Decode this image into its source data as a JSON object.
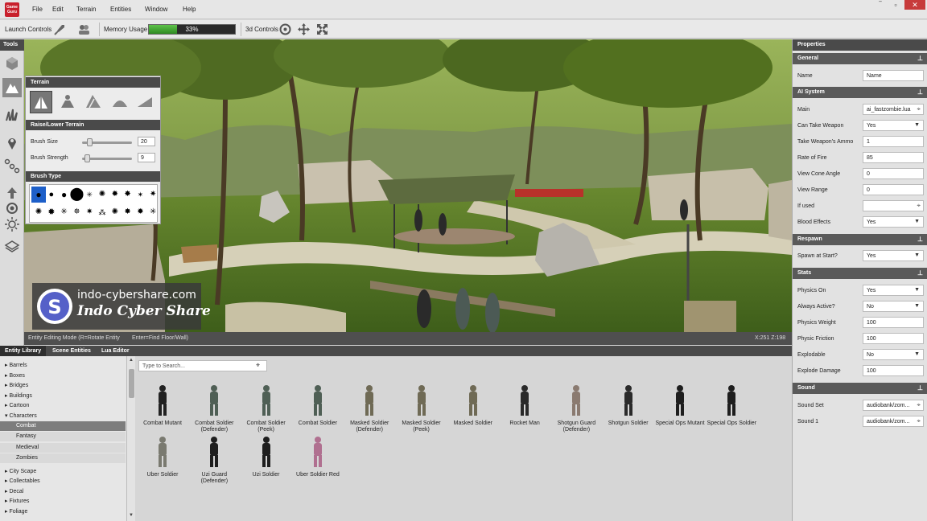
{
  "app": {
    "logo_text": "Game Guru"
  },
  "menu": [
    "File",
    "Edit",
    "Terrain",
    "Entities",
    "Window",
    "Help"
  ],
  "window_controls": [
    "‾",
    "▫",
    "✕"
  ],
  "toolbar": {
    "launch_label": "Launch Controls",
    "memory_label": "Memory Usage",
    "memory_percent": 33,
    "memory_text": "33%",
    "controls3d_label": "3d Controls"
  },
  "tools": {
    "title": "Tools",
    "items": [
      "cube-icon",
      "terrain-icon",
      "grass-icon",
      "marker-icon",
      "waypoint-icon",
      "arrow-up-icon",
      "sun-icon",
      "layers-icon"
    ]
  },
  "terrain_panel": {
    "title": "Terrain",
    "raise_section": "Raise/Lower Terrain",
    "brush_size_label": "Brush Size",
    "brush_size": "20",
    "brush_size_frac": 0.1,
    "brush_strength_label": "Brush Strength",
    "brush_strength": "9",
    "brush_strength_frac": 0.05,
    "brush_type_title": "Brush Type"
  },
  "viewport": {
    "status_mode": "Entity Editing Mode (R=Rotate Entity",
    "status_hint": "Enter=Find Floor/Wall)",
    "coords": "X:251   Z:198",
    "watermark_url": "indo-cybershare.com",
    "watermark_brand": "Indo Cyber Share"
  },
  "properties": {
    "title": "Properties",
    "sections": {
      "general": "General",
      "ai": "AI System",
      "respawn": "Respawn",
      "stats": "Stats",
      "sound": "Sound"
    },
    "name_label": "Name",
    "name_value": "Name",
    "main_label": "Main",
    "main_value": "ai_fastzombie.lua",
    "can_take_weapon_label": "Can Take Weapon",
    "can_take_weapon": "Yes",
    "ammo_label": "Take Weapon's Ammo",
    "ammo": "1",
    "rate_label": "Rate of Fire",
    "rate": "85",
    "cone_label": "View Cone Angle",
    "cone": "0",
    "range_label": "View Range",
    "range": "0",
    "ifused_label": "If used",
    "ifused": "",
    "blood_label": "Blood Effects",
    "blood": "Yes",
    "spawn_label": "Spawn at Start?",
    "spawn": "Yes",
    "physics_on_label": "Physics On",
    "physics_on": "Yes",
    "always_active_label": "Always Active?",
    "always_active": "No",
    "weight_label": "Physics Weight",
    "weight": "100",
    "friction_label": "Physic Friction",
    "friction": "100",
    "explodable_label": "Explodable",
    "explodable": "No",
    "explode_damage_label": "Explode Damage",
    "explode_damage": "100",
    "soundset_label": "Sound Set",
    "soundset": "audiobank/zom...",
    "sound1_label": "Sound 1",
    "sound1": "audiobank/zom..."
  },
  "bottom_tabs": [
    "Entity Library",
    "Scene Entities",
    "Lua Editor"
  ],
  "tree": {
    "top": [
      "Barrels",
      "Boxes",
      "Bridges",
      "Buildings",
      "Cartoon"
    ],
    "open": "Characters",
    "children": [
      "Combat",
      "Fantasy",
      "Medieval",
      "Zombies"
    ],
    "bottom": [
      "City Scape",
      "Collectables",
      "Decal",
      "Fixtures",
      "Foliage"
    ]
  },
  "search": {
    "placeholder": "Type to Search..."
  },
  "entities": [
    {
      "name": "Combat Mutant",
      "color": "#222222"
    },
    {
      "name": "Combat Soldier (Defender)",
      "color": "#4f5f55"
    },
    {
      "name": "Combat Soldier (Peek)",
      "color": "#4f5f55"
    },
    {
      "name": "Combat Soldier",
      "color": "#4f5f55"
    },
    {
      "name": "Masked Soldier (Defender)",
      "color": "#6f6a55"
    },
    {
      "name": "Masked Soldier (Peek)",
      "color": "#6f6a55"
    },
    {
      "name": "Masked Soldier",
      "color": "#6f6a55"
    },
    {
      "name": "Rocket Man",
      "color": "#2a2a2a"
    },
    {
      "name": "Shotgun Guard (Defender)",
      "color": "#8a7a70"
    },
    {
      "name": "Shotgun Soldier",
      "color": "#2a2a2a"
    },
    {
      "name": "Special Ops Mutant",
      "color": "#1e1e1e"
    },
    {
      "name": "Special Ops Soldier",
      "color": "#1e1e1e"
    },
    {
      "name": "Uber Soldier",
      "color": "#7a7a70"
    },
    {
      "name": "Uzi Guard (Defender)",
      "color": "#1e1e1e"
    },
    {
      "name": "Uzi Soldier",
      "color": "#1e1e1e"
    },
    {
      "name": "Uber Soldier Red",
      "color": "#b07090"
    }
  ]
}
